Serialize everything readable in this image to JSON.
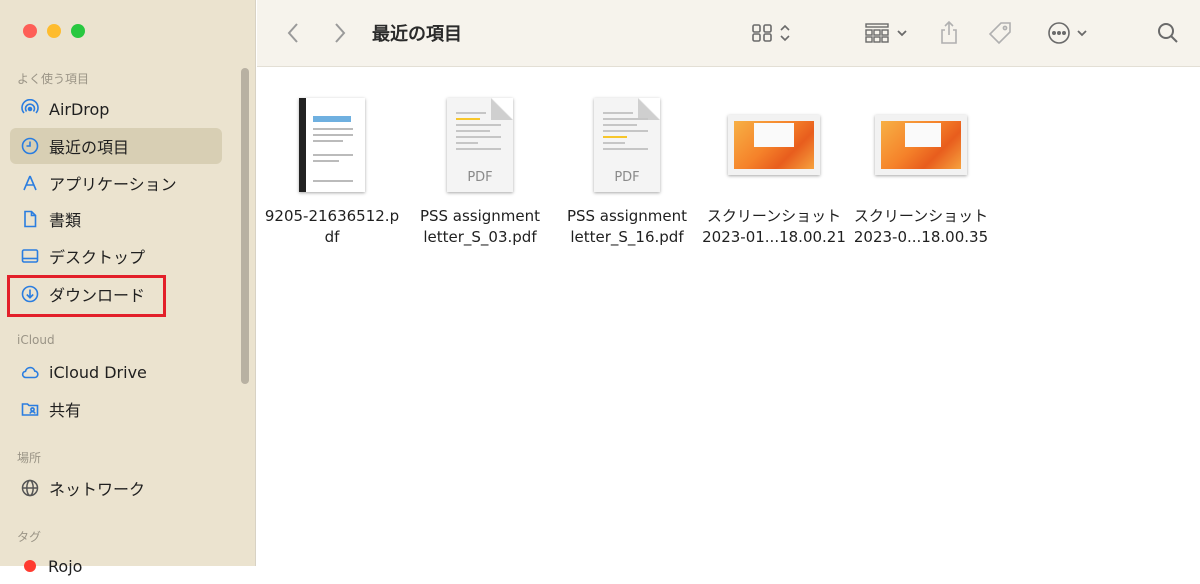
{
  "window": {
    "title": "最近の項目"
  },
  "sidebar": {
    "favorites_header": "よく使う項目",
    "favorites": [
      {
        "label": "AirDrop",
        "icon": "airdrop-icon"
      },
      {
        "label": "最近の項目",
        "icon": "clock-icon",
        "active": true
      },
      {
        "label": "アプリケーション",
        "icon": "applications-icon"
      },
      {
        "label": "書類",
        "icon": "document-icon"
      },
      {
        "label": "デスクトップ",
        "icon": "desktop-icon"
      },
      {
        "label": "ダウンロード",
        "icon": "download-icon",
        "highlighted": true
      }
    ],
    "icloud_header": "iCloud",
    "icloud": [
      {
        "label": "iCloud Drive",
        "icon": "cloud-icon"
      },
      {
        "label": "共有",
        "icon": "shared-folder-icon"
      }
    ],
    "locations_header": "場所",
    "locations": [
      {
        "label": "ネットワーク",
        "icon": "globe-icon"
      }
    ],
    "tags_header": "タグ",
    "tags": [
      {
        "label": "Rojo",
        "color": "#ff3b30"
      }
    ]
  },
  "files": [
    {
      "name_line1": "9205-21636512.p",
      "name_line2": "df",
      "kind": "scan-pdf"
    },
    {
      "name_line1": "PSS assignment",
      "name_line2": "letter_S_03.pdf",
      "kind": "pdf",
      "badge": "PDF"
    },
    {
      "name_line1": "PSS assignment",
      "name_line2": "letter_S_16.pdf",
      "kind": "pdf",
      "badge": "PDF"
    },
    {
      "name_line1": "スクリーンショット",
      "name_line2": "2023-01...18.00.21",
      "kind": "screenshot"
    },
    {
      "name_line1": "スクリーンショット",
      "name_line2": "2023-0...18.00.35",
      "kind": "screenshot"
    }
  ],
  "colors": {
    "accent": "#2a7de0",
    "highlight_box": "#e3202a",
    "sidebar_bg": "#ebe3cf"
  }
}
